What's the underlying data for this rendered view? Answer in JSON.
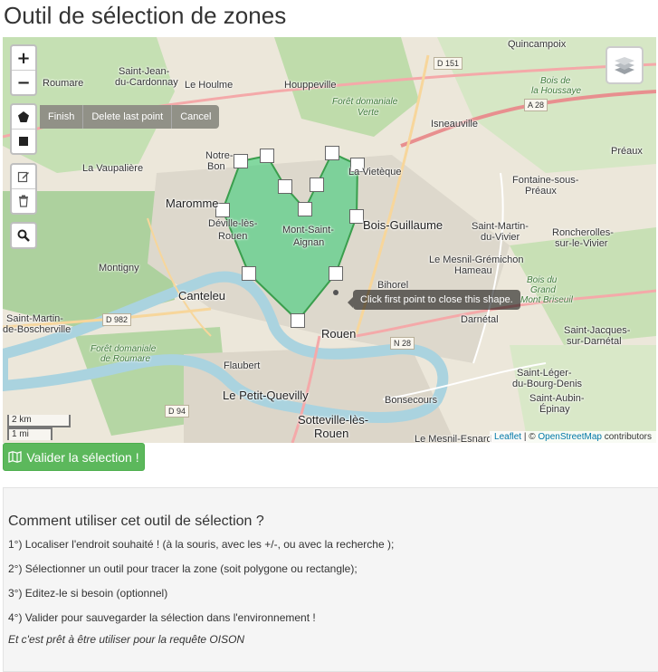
{
  "page": {
    "title": "Outil de sélection de zones"
  },
  "map": {
    "zoom_in_label": "+",
    "zoom_out_label": "−",
    "draw_actions": [
      "Finish",
      "Delete last point",
      "Cancel"
    ],
    "tooltip": "Click first point to close this shape.",
    "scale": {
      "km": "2 km",
      "mi": "1 mi"
    },
    "attribution": {
      "leaflet": "Leaflet",
      "sep": " | © ",
      "osm": "OpenStreetMap",
      "contributors": " contributors"
    },
    "places": {
      "roumare": "Roumare",
      "saint_jean": "Saint-Jean-",
      "saint_jean2": "du-Cardonnay",
      "le_houlme": "Le Houlme",
      "houppeville": "Houppeville",
      "quincampoix": "Quincampoix",
      "bois_houssaye": "Bois de",
      "bois_houssaye2": "la Houssaye",
      "foret_verte": "Forêt domaniale",
      "foret_verte2": "Verte",
      "isneauville": "Isneauville",
      "preaux": "Préaux",
      "la_vaupaliere": "La Vaupalière",
      "notre_dame": "Notre-",
      "notre_dame2": "Bon",
      "la_vieteque": "La Vietèque",
      "fontaine": "Fontaine-sous-",
      "fontaine2": "Préaux",
      "maromme": "Maromme",
      "deville": "Déville-lès-",
      "deville2": "Rouen",
      "mont_saint_aignan": "Mont-Saint-",
      "mont_saint_aignan2": "Aignan",
      "bois_guillaume": "Bois-Guillaume",
      "saint_martin_vivier": "Saint-Martin-",
      "saint_martin_vivier2": "du-Vivier",
      "roncherolles": "Roncherolles-",
      "roncherolles2": "sur-le-Vivier",
      "mesnil_gremichon": "Le Mesnil-Grémichon",
      "hameau": "Hameau",
      "montigny": "Montigny",
      "bois_grand_mont": "Bois du",
      "bois_grand_mont2": "Grand",
      "bois_grand_mont3": "Mont Briseuil",
      "canteleu": "Canteleu",
      "bihorel": "Bihorel",
      "saint_martin_boscherville": "Saint-Martin-",
      "saint_martin_boscherville2": "de-Boscherville",
      "darnetal": "Darnétal",
      "saint_jacques": "Saint-Jacques-",
      "saint_jacques2": "sur-Darnétal",
      "rouen": "Rouen",
      "foret_roumare": "Forêt domaniale",
      "foret_roumare2": "de Roumare",
      "flaubert": "Flaubert",
      "saint_leger": "Saint-Léger-",
      "saint_leger2": "du-Bourg-Denis",
      "petit_quevilly": "Le Petit-Quevilly",
      "bonsecours": "Bonsecours",
      "saint_aubin": "Saint-Aubin-",
      "saint_aubin2": "Épinay",
      "sotteville": "Sotteville-lès-",
      "sotteville2": "Rouen",
      "mesnil_esnard": "Le Mesnil-Esnard"
    },
    "roads": {
      "d151": "D 151",
      "a28": "A 28",
      "d982": "D 982",
      "n28": "N 28",
      "d94": "D 94"
    }
  },
  "validate_button": {
    "label": "Valider la sélection !"
  },
  "help": {
    "title": "Comment utiliser cet outil de sélection ?",
    "steps": [
      "1°) Localiser l'endroit souhaité ! (à la souris, avec les +/-, ou avec la recherche );",
      "2°) Sélectionner un outil pour tracer la zone (soit polygone ou rectangle);",
      "3°) Editez-le si besoin (optionnel)",
      "4°) Valider pour sauvegarder la sélection dans l'environnement !"
    ],
    "note": "Et c'est prêt à être utiliser pour la requête OISON"
  },
  "colors": {
    "polygon_fill": "#2ecc71",
    "polygon_stroke": "#3a9e4d",
    "accent_green": "#5cb85c",
    "river": "#aad3df"
  }
}
